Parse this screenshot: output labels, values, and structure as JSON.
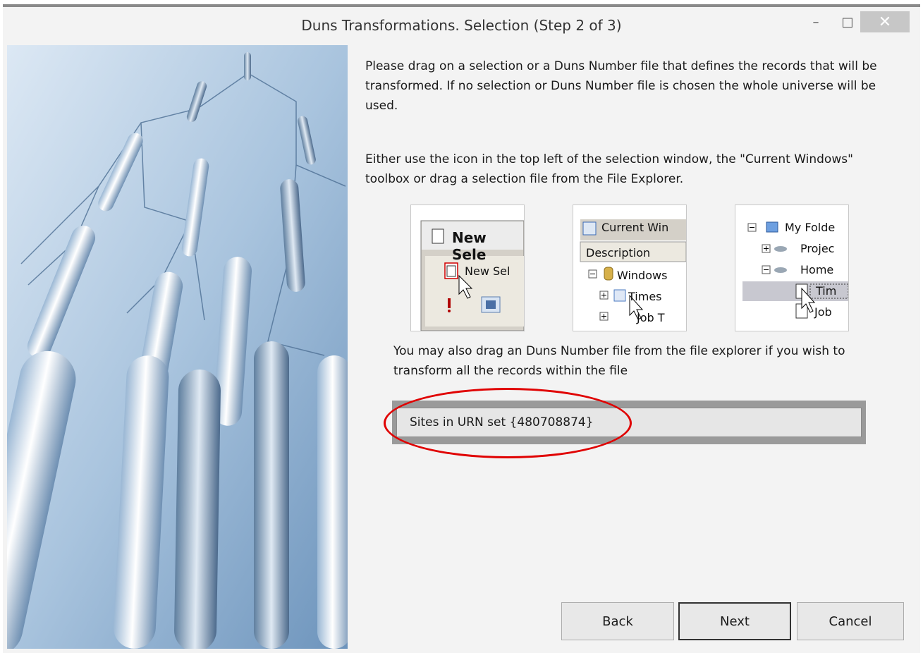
{
  "window": {
    "title": "Duns Transformations.  Selection (Step 2 of 3)",
    "minimize_glyph": "–",
    "maximize_glyph": "□",
    "close_glyph": "✕"
  },
  "instructions": {
    "p1": "Please drag on a selection or a Duns Number file that defines the records that will be transformed.  If no selection or Duns Number file is chosen the whole universe will be used.",
    "p2": "Either use the icon in the top left of the selection window, the \"Current Windows\" toolbox or drag a selection file from the File Explorer.",
    "p3": "You may also drag an Duns Number file from the file explorer if you wish to transform all the records within the file"
  },
  "thumb1": {
    "title": "New Sele",
    "item": "New Sel"
  },
  "thumb2": {
    "title": "Current Win",
    "header": "Description",
    "root": "Windows",
    "child1": "Times",
    "child2": "Job T"
  },
  "thumb3": {
    "root": "My Folde",
    "child1": "Projec",
    "child2": "Home",
    "leaf1": "Tim",
    "leaf2": "Job"
  },
  "selection_field": {
    "value": "Sites in URN set {480708874}"
  },
  "buttons": {
    "back": "Back",
    "next": "Next",
    "cancel": "Cancel"
  },
  "colors": {
    "highlight_ellipse": "#e00000",
    "graphic_blue": "#8fb4d6",
    "window_bg": "#f3f3f3"
  }
}
